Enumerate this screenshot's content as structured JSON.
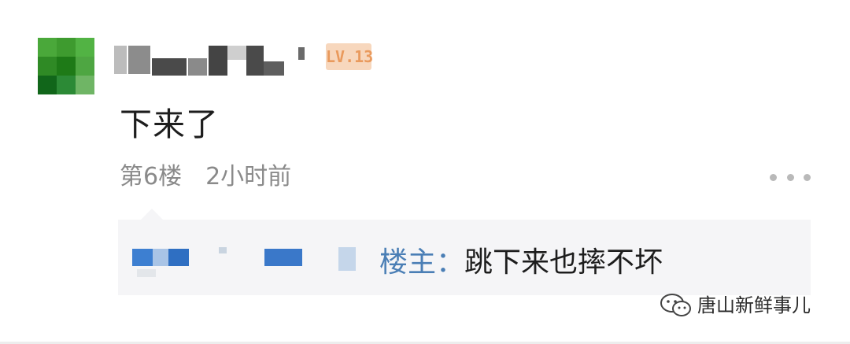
{
  "post": {
    "level_badge": "LV.13",
    "comment_text": "下来了",
    "floor": "第6楼",
    "time": "2小时前"
  },
  "reply": {
    "author_tag": "楼主：",
    "text": "跳下来也摔不坏"
  },
  "watermark": {
    "text": "唐山新鲜事儿",
    "icon": "wechat-icon"
  },
  "icons": {
    "more": "more-dots-icon"
  },
  "colors": {
    "reply_author": "#4a7eb5",
    "badge_bg": "#f7d7bd",
    "badge_text": "#e99a5d",
    "meta_text": "#8a8a8a",
    "reply_bg": "#f5f5f7"
  }
}
